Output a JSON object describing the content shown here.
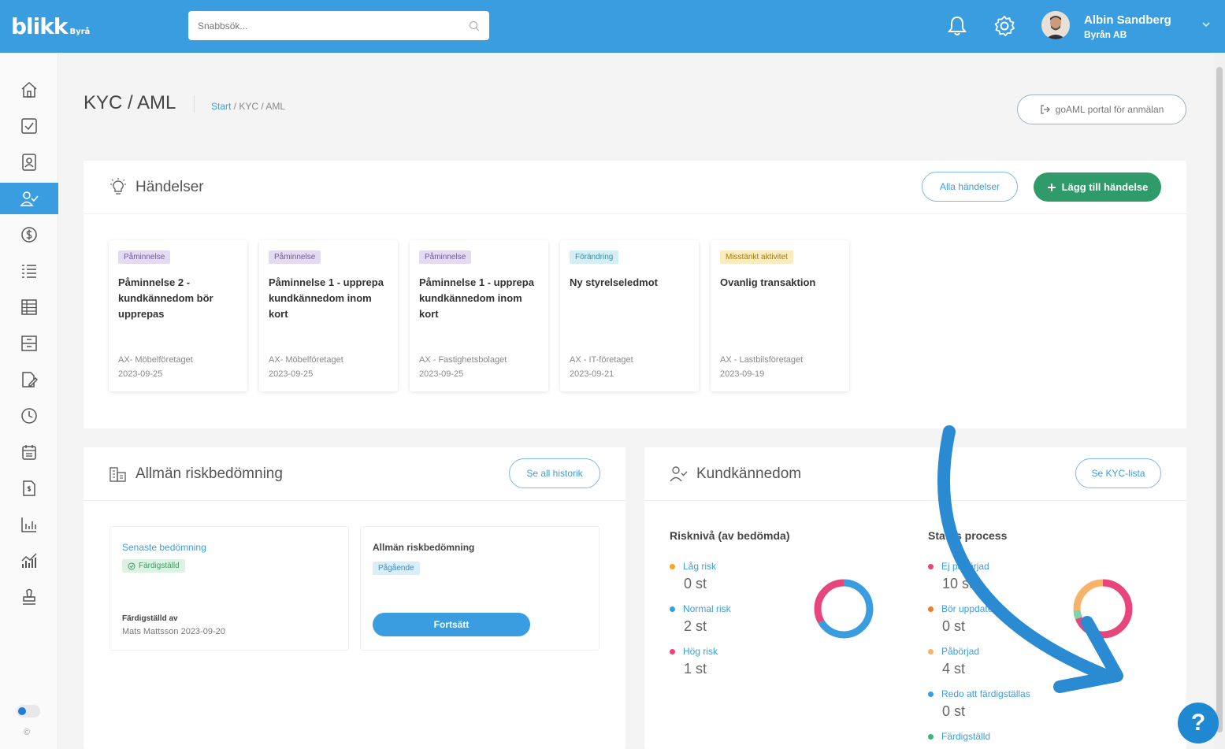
{
  "app": {
    "logo_main": "blikk",
    "logo_sub": "Byrå"
  },
  "search": {
    "placeholder": "Snabbsök..."
  },
  "user": {
    "name": "Albin Sandberg",
    "company": "Byrån AB"
  },
  "page": {
    "title": "KYC / AML",
    "breadcrumb_start": "Start",
    "breadcrumb_rest": " / KYC / AML",
    "goaml_button": "goAML portal för anmälan"
  },
  "events": {
    "title": "Händelser",
    "all_button": "Alla händelser",
    "add_button": "Lägg till händelse",
    "items": [
      {
        "tag": "Påminnelse",
        "title": "Påminnelse 2 - kundkännedom bör upprepas",
        "company": "AX- Möbelföretaget",
        "date": "2023-09-25"
      },
      {
        "tag": "Påminnelse",
        "title": "Påminnelse 1 - upprepa kundkännedom inom kort",
        "company": "AX- Möbelföretaget",
        "date": "2023-09-25"
      },
      {
        "tag": "Påminnelse",
        "title": "Påminnelse 1 - upprepa kundkännedom inom kort",
        "company": "AX - Fastighetsbolaget",
        "date": "2023-09-25"
      },
      {
        "tag": "Förändring",
        "title": "Ny styrelseledmot",
        "company": "AX - IT-företaget",
        "date": "2023-09-21"
      },
      {
        "tag": "Misstänkt aktivitet",
        "title": "Ovanlig transaktion",
        "company": "AX - Lastbilsföretaget",
        "date": "2023-09-19"
      }
    ]
  },
  "risk": {
    "title": "Allmän riskbedömning",
    "history_button": "Se all historik",
    "latest_label": "Senaste bedömning",
    "latest_status": "Färdigställd",
    "completed_by_label": "Färdigställd av",
    "completed_by": "Mats Mattsson 2023-09-20",
    "current_title": "Allmän riskbedömning",
    "current_status": "Pågående",
    "continue_button": "Fortsätt"
  },
  "kyc": {
    "title": "Kundkännedom",
    "list_button": "Se KYC-lista",
    "risk_title": "Risknivå (av bedömda)",
    "risk_levels": [
      {
        "label": "Låg risk",
        "value": "0 st",
        "color": "#f5a623"
      },
      {
        "label": "Normal risk",
        "value": "2 st",
        "color": "#3a9de0"
      },
      {
        "label": "Hög risk",
        "value": "1 st",
        "color": "#e8457a"
      }
    ],
    "status_title": "Status process",
    "status_items": [
      {
        "label": "Ej påbörjad",
        "value": "10 st",
        "color": "#e8457a"
      },
      {
        "label": "Bör uppdateras",
        "value": "0 st",
        "color": "#f07a2a"
      },
      {
        "label": "Påbörjad",
        "value": "4 st",
        "color": "#f7b36a"
      },
      {
        "label": "Redo att färdigställas",
        "value": "0 st",
        "color": "#3a9de0"
      },
      {
        "label": "Färdigställd",
        "value": "",
        "color": "#3fb47a"
      }
    ]
  },
  "footer": {
    "copyright": "©"
  },
  "help": {
    "label": "?"
  }
}
